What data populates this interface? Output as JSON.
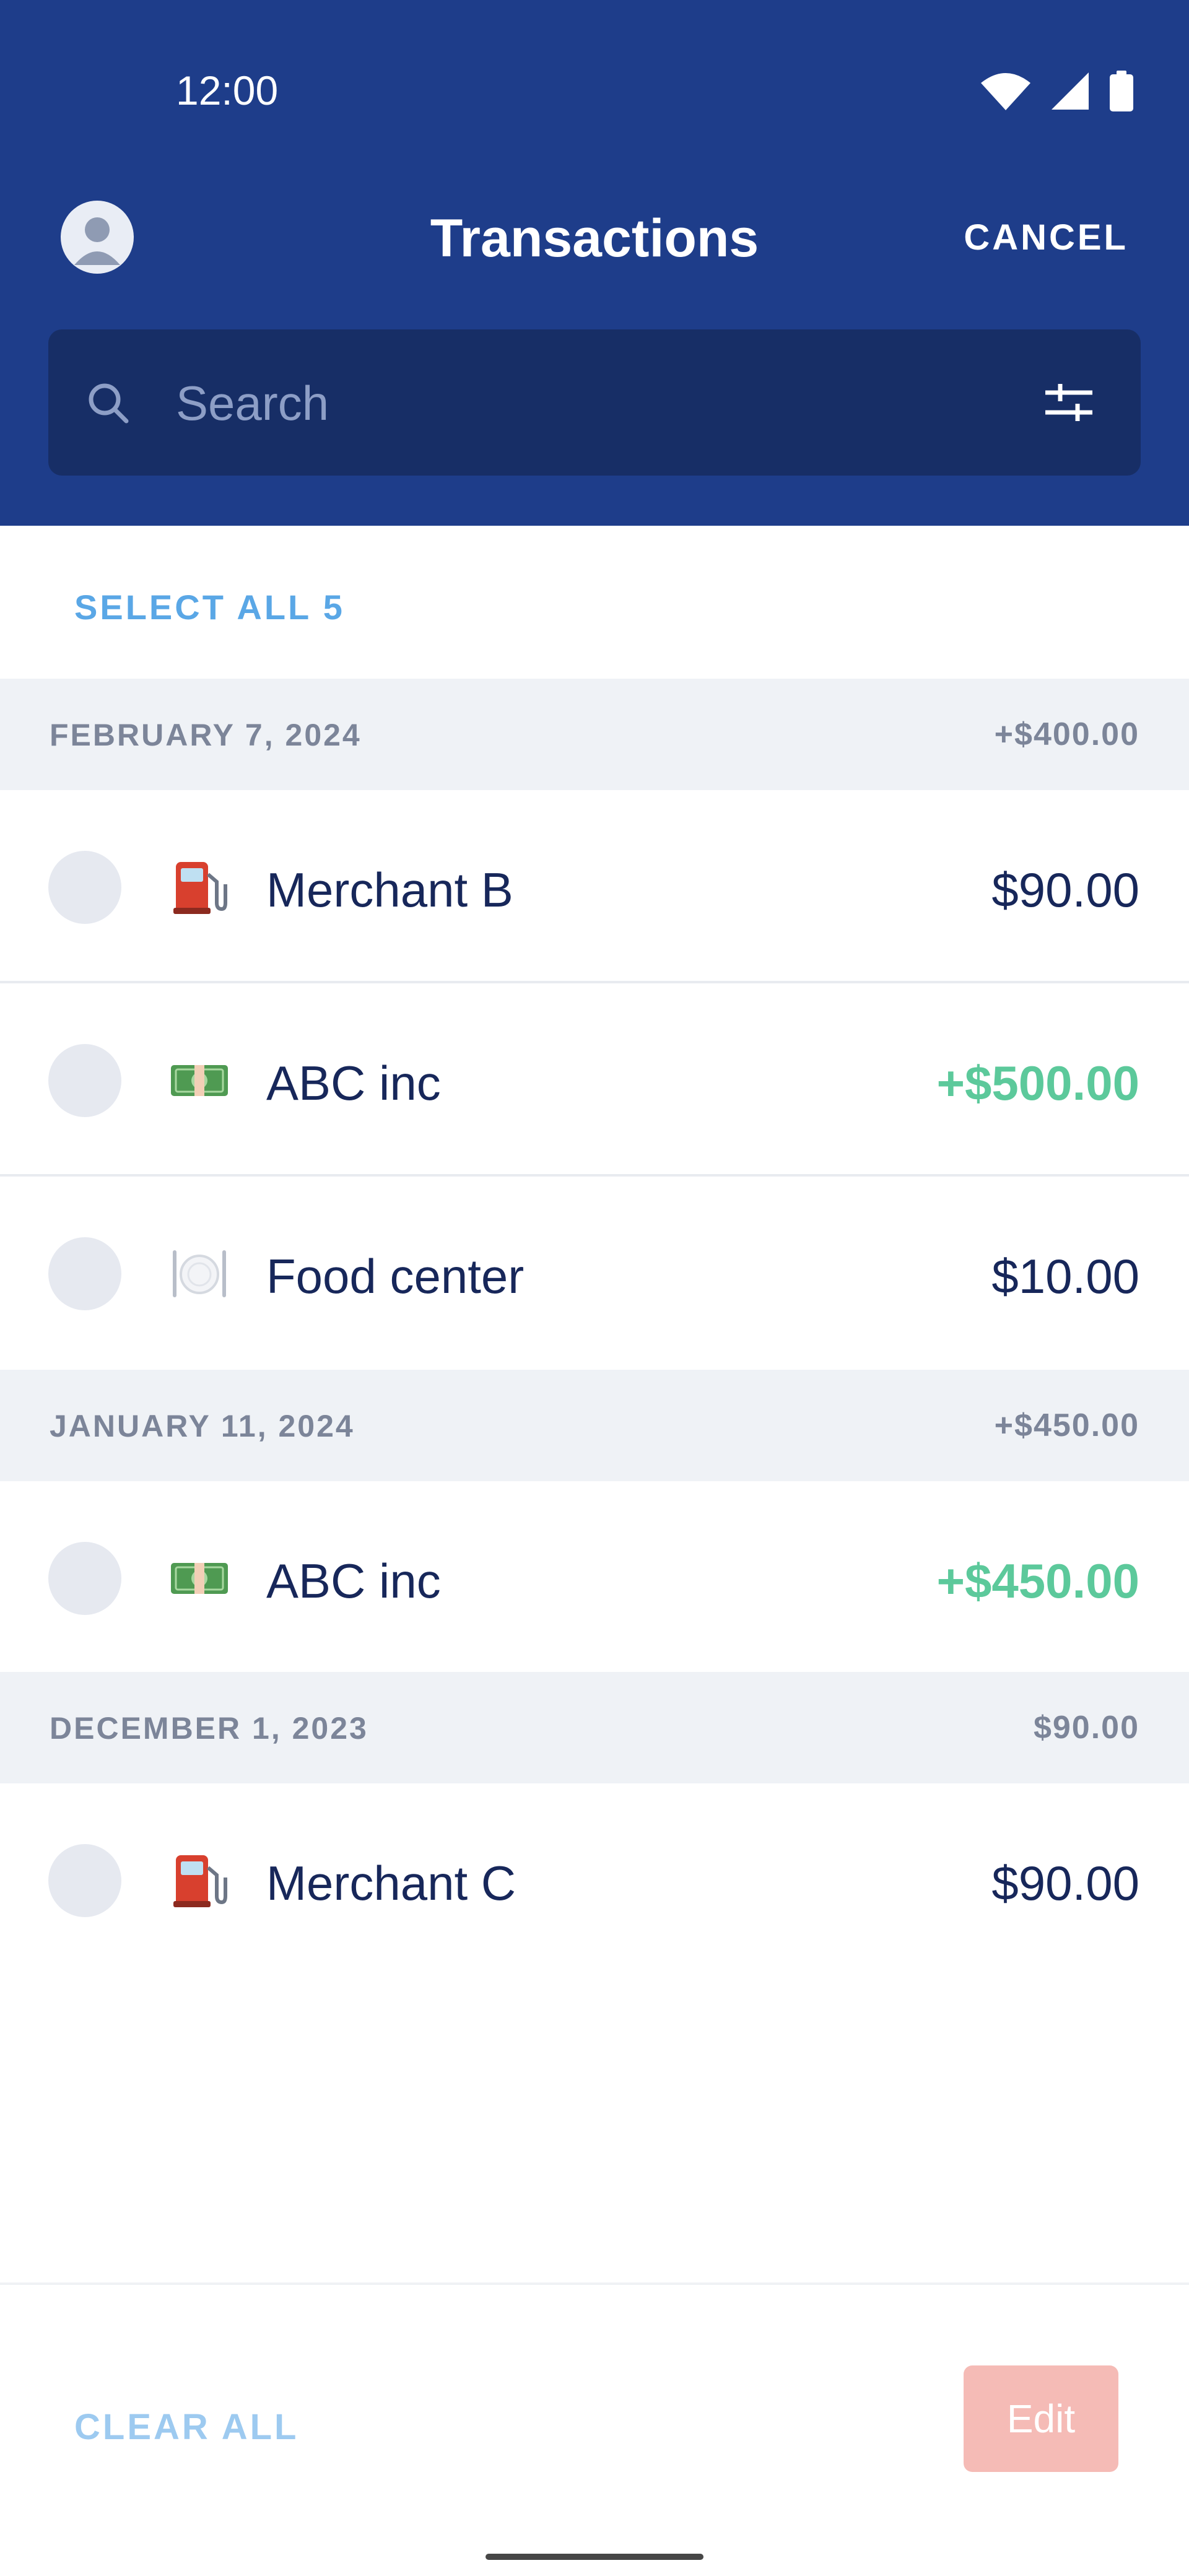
{
  "status_bar": {
    "time": "12:00"
  },
  "header": {
    "title": "Transactions",
    "cancel_label": "CANCEL"
  },
  "search": {
    "placeholder": "Search",
    "value": ""
  },
  "select_all_label": "SELECT ALL 5",
  "groups": [
    {
      "date": "FEBRUARY 7, 2024",
      "total": "+$400.00",
      "transactions": [
        {
          "merchant": "Merchant B",
          "amount": "$90.00",
          "icon": "fuel-pump-icon",
          "credit": false
        },
        {
          "merchant": "ABC inc",
          "amount": "+$500.00",
          "icon": "dollar-bill-icon",
          "credit": true
        },
        {
          "merchant": "Food center",
          "amount": "$10.00",
          "icon": "plate-cutlery-icon",
          "credit": false
        }
      ]
    },
    {
      "date": "JANUARY 11, 2024",
      "total": "+$450.00",
      "transactions": [
        {
          "merchant": "ABC inc",
          "amount": "+$450.00",
          "icon": "dollar-bill-icon",
          "credit": true
        }
      ]
    },
    {
      "date": "DECEMBER 1, 2023",
      "total": "$90.00",
      "transactions": [
        {
          "merchant": "Merchant C",
          "amount": "$90.00",
          "icon": "fuel-pump-icon",
          "credit": false
        }
      ]
    }
  ],
  "footer": {
    "clear_all_label": "CLEAR ALL",
    "edit_label": "Edit"
  },
  "colors": {
    "header_bg": "#1e3d8a",
    "search_bg": "#172e66",
    "link": "#5aa7e6",
    "credit": "#5cc99b",
    "text": "#17275a",
    "edit_disabled": "#f5bbb6"
  }
}
